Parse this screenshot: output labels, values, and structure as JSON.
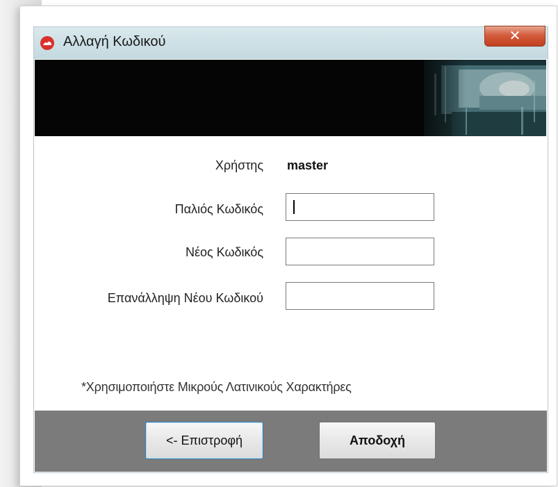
{
  "window": {
    "title": "Αλλαγή Κωδικού",
    "close_glyph": "✕"
  },
  "form": {
    "user_label": "Χρήστης",
    "user_value": "master",
    "old_password_label": "Παλιός Κωδικός",
    "old_password_value": "",
    "new_password_label": "Νέος Κωδικός",
    "new_password_value": "",
    "repeat_password_label": "Επανάλληψη Νέου Κωδικού",
    "repeat_password_value": ""
  },
  "note": "*Χρησιμοποιήστε Μικρούς Λατινικούς Χαρακτήρες",
  "buttons": {
    "back_label": "<- Επιστροφή",
    "accept_label": "Αποδοχή"
  },
  "colors": {
    "titlebar": "#cde0e5",
    "close_button": "#c2401e",
    "banner": "#050505",
    "footer": "#7b7b7b",
    "app_icon": "#d9322b"
  }
}
